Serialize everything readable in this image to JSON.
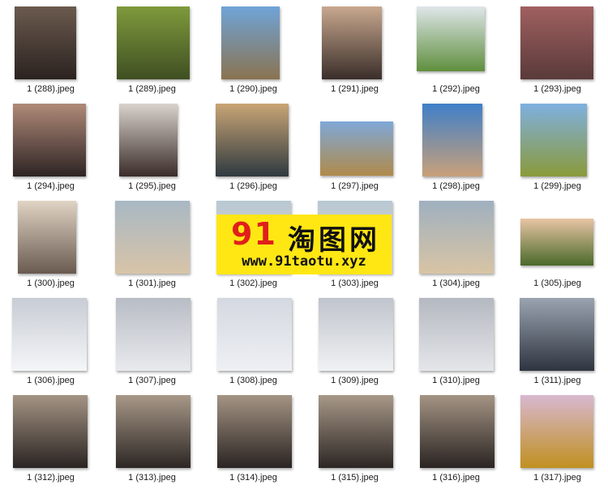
{
  "files": [
    {
      "name": "1 (288).jpeg",
      "g": [
        "#6b5a4e",
        "#2b2220"
      ]
    },
    {
      "name": "1 (289).jpeg",
      "g": [
        "#7f9a3c",
        "#3f4f22"
      ]
    },
    {
      "name": "1 (290).jpeg",
      "g": [
        "#6fa4d8",
        "#8a7350"
      ]
    },
    {
      "name": "1 (291).jpeg",
      "g": [
        "#c8a88e",
        "#3a2e2a"
      ]
    },
    {
      "name": "1 (292).jpeg",
      "g": [
        "#dfe6ea",
        "#5f8f3d"
      ]
    },
    {
      "name": "1 (293).jpeg",
      "g": [
        "#a06060",
        "#5a3a3a"
      ]
    },
    {
      "name": "1 (294).jpeg",
      "g": [
        "#b08a78",
        "#2e2424"
      ]
    },
    {
      "name": "1 (295).jpeg",
      "g": [
        "#d9d3cc",
        "#3a2c2a"
      ]
    },
    {
      "name": "1 (296).jpeg",
      "g": [
        "#c9a575",
        "#2f3a40"
      ]
    },
    {
      "name": "1 (297).jpeg",
      "g": [
        "#7fa8d8",
        "#b08a4a"
      ]
    },
    {
      "name": "1 (298).jpeg",
      "g": [
        "#3f7fc8",
        "#c9a07a"
      ]
    },
    {
      "name": "1 (299).jpeg",
      "g": [
        "#7fb0e0",
        "#8a9a3a"
      ]
    },
    {
      "name": "1 (300).jpeg",
      "g": [
        "#e0d4c4",
        "#6a5a50"
      ]
    },
    {
      "name": "1 (301).jpeg",
      "g": [
        "#a8b8c4",
        "#d8c4a8"
      ]
    },
    {
      "name": "1 (302).jpeg",
      "g": [
        "#b8c8d4",
        "#e4d4bc"
      ]
    },
    {
      "name": "1 (303).jpeg",
      "g": [
        "#b8c8d4",
        "#e4d4bc"
      ]
    },
    {
      "name": "1 (304).jpeg",
      "g": [
        "#9fb0c0",
        "#d8c4a4"
      ]
    },
    {
      "name": "1 (305).jpeg",
      "g": [
        "#e8c4a4",
        "#4a6a2a"
      ]
    },
    {
      "name": "1 (306).jpeg",
      "g": [
        "#c8ccd4",
        "#f4f6f8"
      ]
    },
    {
      "name": "1 (307).jpeg",
      "g": [
        "#b8bcc4",
        "#e8eaee"
      ]
    },
    {
      "name": "1 (308).jpeg",
      "g": [
        "#d4d8e0",
        "#eef0f4"
      ]
    },
    {
      "name": "1 (309).jpeg",
      "g": [
        "#c0c4cc",
        "#f0f2f4"
      ]
    },
    {
      "name": "1 (310).jpeg",
      "g": [
        "#b4b8c0",
        "#e4e6ea"
      ]
    },
    {
      "name": "1 (311).jpeg",
      "g": [
        "#9aa4b0",
        "#2e3440"
      ]
    },
    {
      "name": "1 (312).jpeg",
      "g": [
        "#a49484",
        "#2a2422"
      ]
    },
    {
      "name": "1 (313).jpeg",
      "g": [
        "#a89888",
        "#2c2624"
      ]
    },
    {
      "name": "1 (314).jpeg",
      "g": [
        "#a49484",
        "#2a2422"
      ]
    },
    {
      "name": "1 (315).jpeg",
      "g": [
        "#a89888",
        "#2c2624"
      ]
    },
    {
      "name": "1 (316).jpeg",
      "g": [
        "#a49484",
        "#2a2422"
      ]
    },
    {
      "name": "1 (317).jpeg",
      "g": [
        "#d8b8d0",
        "#c09020"
      ]
    }
  ],
  "watermark": {
    "number": "91",
    "title": "淘图网",
    "url": "www.91taotu.xyz"
  }
}
